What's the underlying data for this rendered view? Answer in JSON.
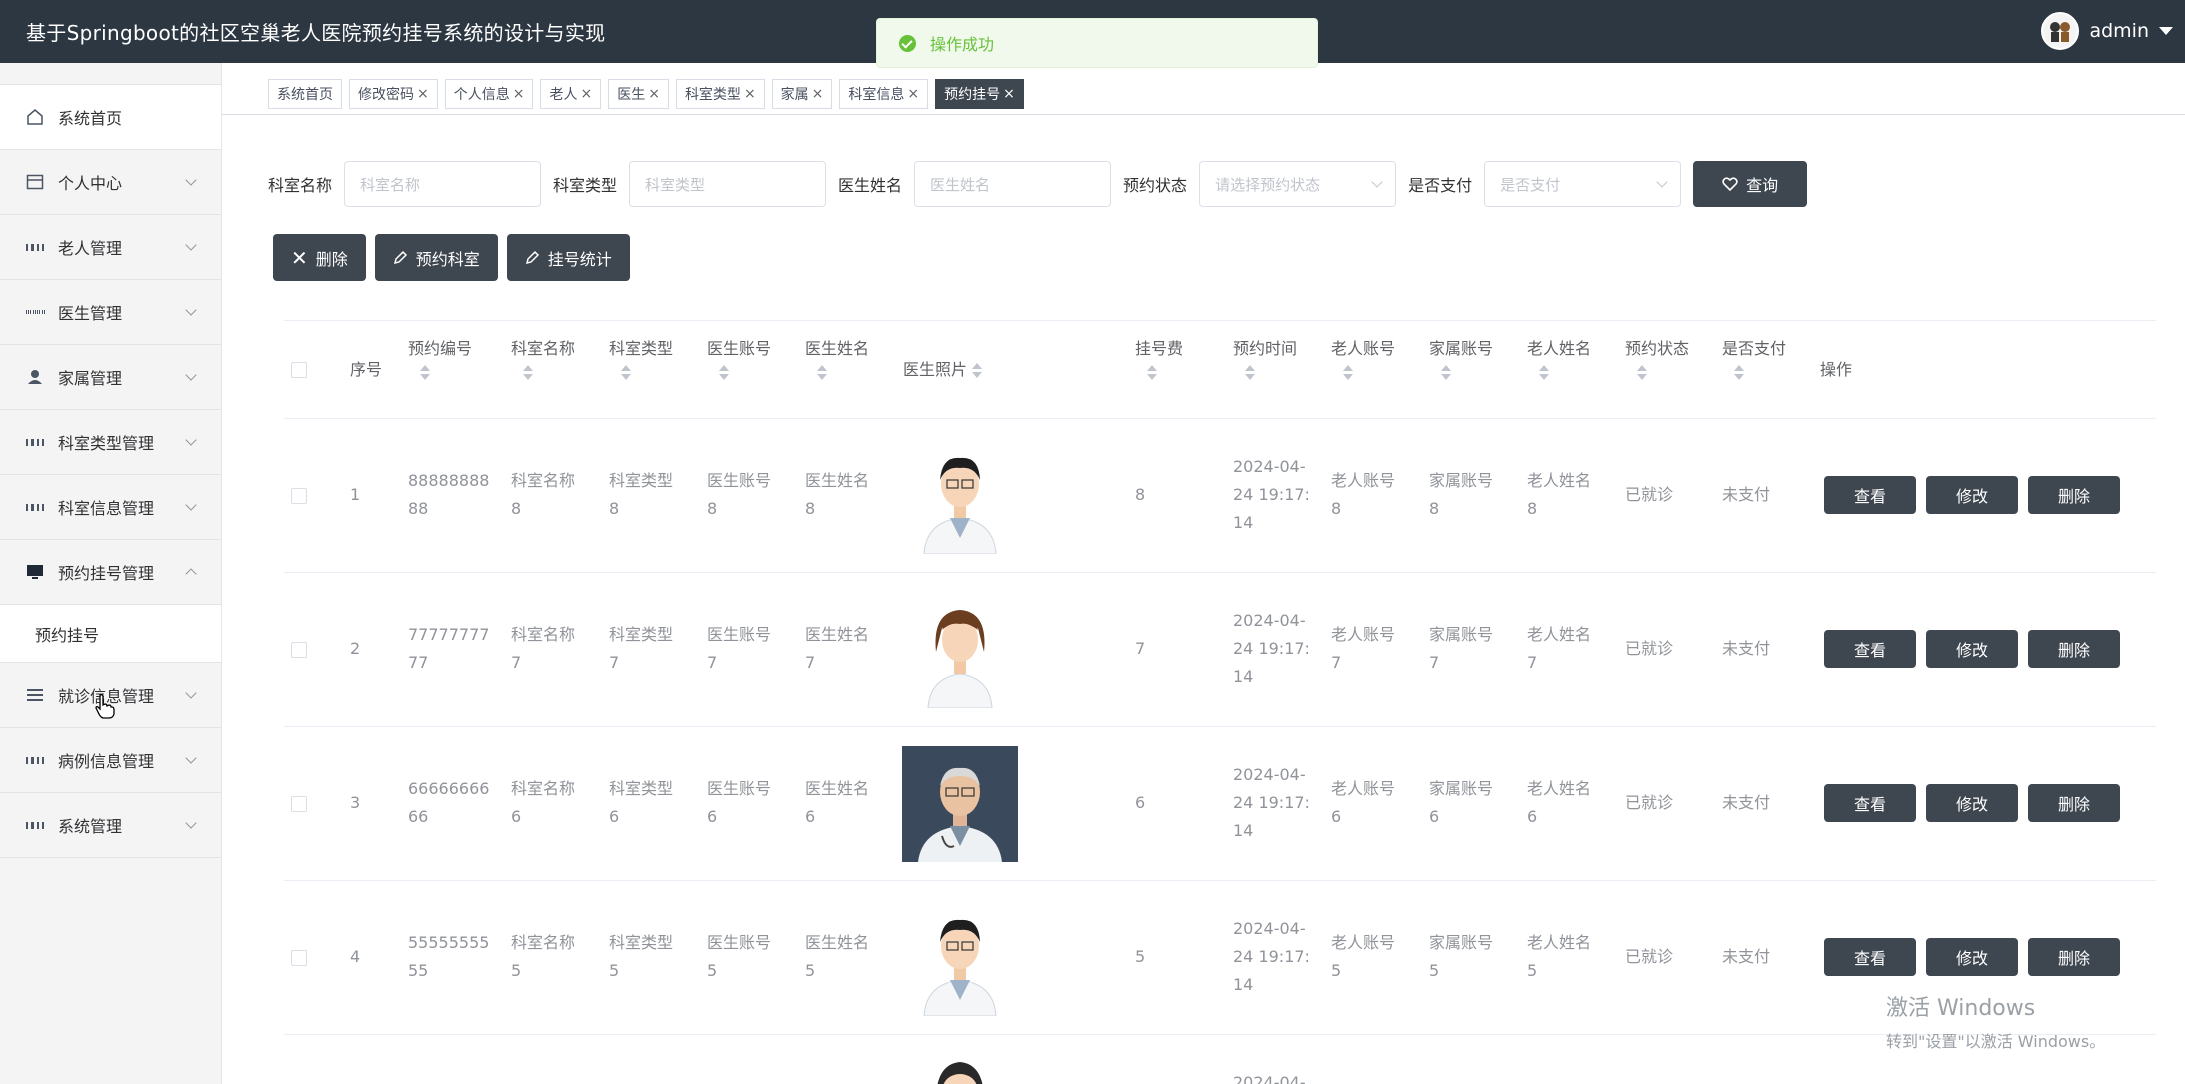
{
  "header": {
    "title": "基于Springboot的社区空巢老人医院预约挂号系统的设计与实现",
    "user": "admin"
  },
  "toast": {
    "message": "操作成功"
  },
  "sidebar": {
    "items": [
      {
        "label": "系统首页",
        "icon": "home-icon"
      },
      {
        "label": "个人中心",
        "icon": "calendar-icon"
      },
      {
        "label": "老人管理",
        "icon": "grid-icon"
      },
      {
        "label": "医生管理",
        "icon": "grid9-icon"
      },
      {
        "label": "家属管理",
        "icon": "user-icon"
      },
      {
        "label": "科室类型管理",
        "icon": "grid-icon"
      },
      {
        "label": "科室信息管理",
        "icon": "grid-icon"
      },
      {
        "label": "预约挂号管理",
        "icon": "monitor-icon"
      },
      {
        "label": "就诊信息管理",
        "icon": "list-icon"
      },
      {
        "label": "病例信息管理",
        "icon": "grid-icon"
      },
      {
        "label": "系统管理",
        "icon": "grid-icon"
      }
    ],
    "submenu": "预约挂号"
  },
  "tags": [
    "系统首页",
    "修改密码",
    "个人信息",
    "老人",
    "医生",
    "科室类型",
    "家属",
    "科室信息",
    "预约挂号"
  ],
  "search": {
    "labels": [
      "科室名称",
      "科室类型",
      "医生姓名",
      "预约状态",
      "是否支付"
    ],
    "placeholders": [
      "科室名称",
      "科室类型",
      "医生姓名",
      "请选择预约状态",
      "是否支付"
    ],
    "button": "查询"
  },
  "actions": {
    "delete": "删除",
    "book": "预约科室",
    "stats": "挂号统计"
  },
  "table": {
    "headers": [
      "序号",
      "预约编号",
      "科室名称",
      "科室类型",
      "医生账号",
      "医生姓名",
      "医生照片",
      "挂号费",
      "预约时间",
      "老人账号",
      "家属账号",
      "老人姓名",
      "预约状态",
      "是否支付",
      "操作"
    ],
    "buttons": {
      "view": "查看",
      "edit": "修改",
      "delete": "删除"
    },
    "rows": [
      {
        "idx": "1",
        "no1": "88888888",
        "no2": "88",
        "dept1": "科室名称",
        "dept2": "8",
        "type1": "科室类型",
        "type2": "8",
        "dacc1": "医生账号",
        "dacc2": "8",
        "dname1": "医生姓名",
        "dname2": "8",
        "fee": "8",
        "t1": "2024-04-",
        "t2": "24 19:17:",
        "t3": "14",
        "eacc1": "老人账号",
        "eacc2": "8",
        "facc1": "家属账号",
        "facc2": "8",
        "ename1": "老人姓名",
        "ename2": "8",
        "status": "已就诊",
        "paid": "未支付"
      },
      {
        "idx": "2",
        "no1": "77777777",
        "no2": "77",
        "dept1": "科室名称",
        "dept2": "7",
        "type1": "科室类型",
        "type2": "7",
        "dacc1": "医生账号",
        "dacc2": "7",
        "dname1": "医生姓名",
        "dname2": "7",
        "fee": "7",
        "t1": "2024-04-",
        "t2": "24 19:17:",
        "t3": "14",
        "eacc1": "老人账号",
        "eacc2": "7",
        "facc1": "家属账号",
        "facc2": "7",
        "ename1": "老人姓名",
        "ename2": "7",
        "status": "已就诊",
        "paid": "未支付"
      },
      {
        "idx": "3",
        "no1": "66666666",
        "no2": "66",
        "dept1": "科室名称",
        "dept2": "6",
        "type1": "科室类型",
        "type2": "6",
        "dacc1": "医生账号",
        "dacc2": "6",
        "dname1": "医生姓名",
        "dname2": "6",
        "fee": "6",
        "t1": "2024-04-",
        "t2": "24 19:17:",
        "t3": "14",
        "eacc1": "老人账号",
        "eacc2": "6",
        "facc1": "家属账号",
        "facc2": "6",
        "ename1": "老人姓名",
        "ename2": "6",
        "status": "已就诊",
        "paid": "未支付"
      },
      {
        "idx": "4",
        "no1": "55555555",
        "no2": "55",
        "dept1": "科室名称",
        "dept2": "5",
        "type1": "科室类型",
        "type2": "5",
        "dacc1": "医生账号",
        "dacc2": "5",
        "dname1": "医生姓名",
        "dname2": "5",
        "fee": "5",
        "t1": "2024-04-",
        "t2": "24 19:17:",
        "t3": "14",
        "eacc1": "老人账号",
        "eacc2": "5",
        "facc1": "家属账号",
        "facc2": "5",
        "ename1": "老人姓名",
        "ename2": "5",
        "status": "已就诊",
        "paid": "未支付"
      }
    ],
    "partial_row": {
      "t1": "2024-04-"
    }
  },
  "watermark": {
    "line1": "激活 Windows",
    "line2": "转到\"设置\"以激活 Windows。"
  }
}
